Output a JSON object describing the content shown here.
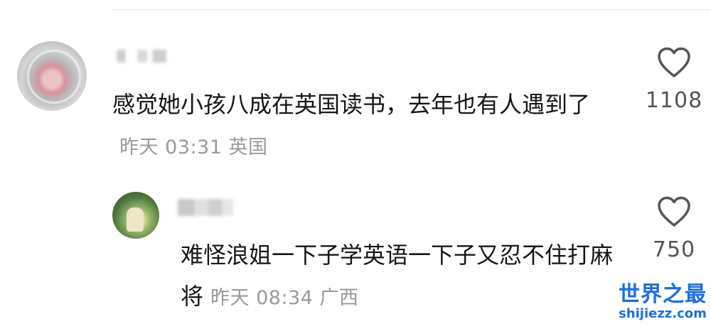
{
  "comments": [
    {
      "text": "感觉她小孩八成在英国读书，去年也有人遇到了",
      "time": "昨天 03:31",
      "location": "英国",
      "likes": "1108"
    },
    {
      "text": "难怪浪姐一下子学英语一下子又忍不住打麻将",
      "time": "昨天 08:34",
      "location": "广西",
      "likes": "750"
    }
  ],
  "watermark": {
    "title": "世界之最",
    "url": "shijiezz.com"
  }
}
